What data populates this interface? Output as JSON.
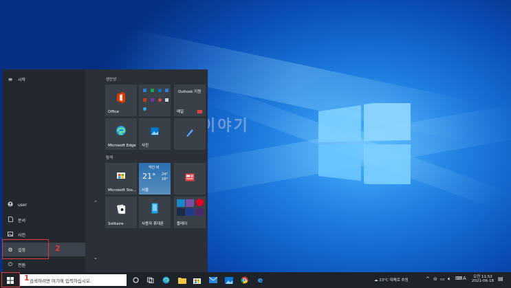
{
  "start_menu": {
    "title": "시작",
    "user": "user",
    "documents": "문서",
    "pictures": "사진",
    "settings": "설정",
    "power": "전원"
  },
  "groups": {
    "productivity": "생산성",
    "explore": "탐색"
  },
  "tiles": {
    "office": "Office",
    "outlook": "Outlook 지원",
    "mail": "메일",
    "edge": "Microsoft Edge",
    "photos": "사진",
    "store": "Microsoft Sto...",
    "weather_top": "약간 비",
    "weather_temp": "21°",
    "weather_hi": "24°",
    "weather_lo": "18°",
    "weather_city": "서울",
    "solitaire": "Solitaire",
    "phone": "사용자 휴대폰",
    "play": "플레이"
  },
  "taskbar": {
    "search_placeholder": "검색하려면 여기에 입력하십시오.",
    "weather": "23°C 대체로 흐림",
    "lang": "A",
    "time": "오전 11:52",
    "date": "2021-06-18"
  },
  "watermark": "프로젝터이야기",
  "annotations": {
    "step1": "1",
    "step2": "2"
  },
  "colors": {
    "accent_red": "#e03a3a",
    "start_bg": "#2b3038",
    "taskbar_bg": "#1e2229"
  }
}
